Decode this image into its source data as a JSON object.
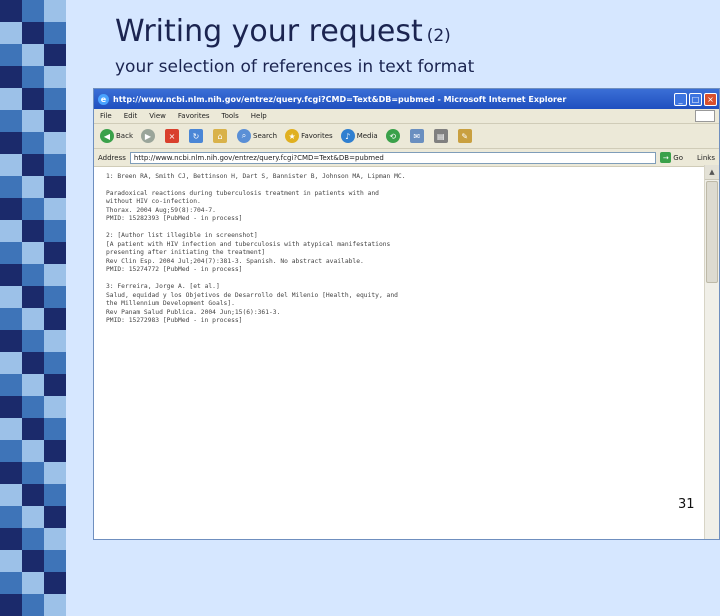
{
  "slide": {
    "title": "Writing your request",
    "title_suffix": "(2)",
    "subtitle": "your selection of references in text format",
    "page_number": "31"
  },
  "colors": {
    "stripe_dark": "#1b2a6b",
    "stripe_mid": "#3e74b8",
    "stripe_light": "#9cc1e8",
    "background": "#d6e7ff",
    "titlebar": "#2a5bc8"
  },
  "browser": {
    "title": "http://www.ncbi.nlm.nih.gov/entrez/query.fcgi?CMD=Text&DB=pubmed - Microsoft Internet Explorer",
    "menu": [
      "File",
      "Edit",
      "View",
      "Favorites",
      "Tools",
      "Help"
    ],
    "toolbar": {
      "back": "Back",
      "search": "Search",
      "favorites": "Favorites",
      "media": "Media"
    },
    "address_label": "Address",
    "address": "http://www.ncbi.nlm.nih.gov/entrez/query.fcgi?CMD=Text&DB=pubmed",
    "go": "Go",
    "links": "Links"
  },
  "content_lines": [
    "1: Breen RA, Smith CJ, Bettinson H, Dart S, Bannister B, Johnson MA, Lipman MC.",
    "",
    "Paradoxical reactions during tuberculosis treatment in patients with and",
    "without HIV co-infection.",
    "Thorax. 2004 Aug;59(8):704-7.",
    "PMID: 15282393 [PubMed - in process]",
    "",
    "2: [Author list illegible in screenshot]",
    "[A patient with HIV infection and tuberculosis with atypical manifestations",
    "presenting after initiating the treatment]",
    "Rev Clin Esp. 2004 Jul;204(7):381-3. Spanish. No abstract available.",
    "PMID: 15274772 [PubMed - in process]",
    "",
    "3: Ferreira, Jorge A. [et al.]",
    "Salud, equidad y los Objetivos de Desarrollo del Milenio [Health, equity, and",
    "the Millennium Development Goals].",
    "Rev Panam Salud Publica. 2004 Jun;15(6):361-3.",
    "PMID: 15272983 [PubMed - in process]"
  ]
}
